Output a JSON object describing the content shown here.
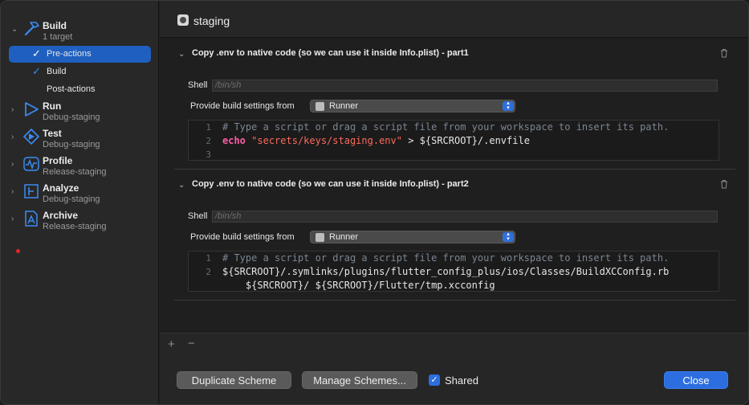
{
  "sidebar": {
    "actions": [
      {
        "title": "Build",
        "subtitle": "1 target",
        "icon": "hammer-icon",
        "expanded": true
      },
      {
        "title": "Run",
        "subtitle": "Debug-staging",
        "icon": "play-icon"
      },
      {
        "title": "Test",
        "subtitle": "Debug-staging",
        "icon": "test-diamond-icon"
      },
      {
        "title": "Profile",
        "subtitle": "Release-staging",
        "icon": "waveform-icon"
      },
      {
        "title": "Analyze",
        "subtitle": "Debug-staging",
        "icon": "analyze-icon"
      },
      {
        "title": "Archive",
        "subtitle": "Release-staging",
        "icon": "archive-icon"
      }
    ],
    "build_sub": [
      {
        "label": "Pre-actions",
        "checked": true,
        "selected": true
      },
      {
        "label": "Build",
        "checked": true,
        "selected": false
      },
      {
        "label": "Post-actions",
        "checked": false,
        "selected": false
      }
    ]
  },
  "header": {
    "title": "staging",
    "icon": "scheme-icon"
  },
  "phases": [
    {
      "title": "Copy .env to native code (so we can use it inside Info.plist) - part1",
      "shell_label": "Shell",
      "shell_placeholder": "/bin/sh",
      "provide_label": "Provide build settings from",
      "provide_value": "Runner",
      "code": [
        {
          "n": "1",
          "text": "# Type a script or drag a script file from your workspace to insert its path."
        },
        {
          "n": "2",
          "kw": "echo",
          "str": "\"secrets/keys/staging.env\"",
          "rest": " > ${SRCROOT}/.envfile"
        },
        {
          "n": "3",
          "text": ""
        }
      ]
    },
    {
      "title": "Copy .env to native code (so we can use it inside Info.plist) - part2",
      "shell_label": "Shell",
      "shell_placeholder": "/bin/sh",
      "provide_label": "Provide build settings from",
      "provide_value": "Runner",
      "code": [
        {
          "n": "1",
          "text": "# Type a script or drag a script file from your workspace to insert its path."
        },
        {
          "n": "2",
          "text": "${SRCROOT}/.symlinks/plugins/flutter_config_plus/ios/Classes/BuildXCConfig.rb"
        },
        {
          "n": "",
          "text": "    ${SRCROOT}/ ${SRCROOT}/Flutter/tmp.xcconfig"
        }
      ]
    }
  ],
  "toolbar": {
    "add": "+",
    "remove": "−"
  },
  "footer": {
    "duplicate": "Duplicate Scheme",
    "manage": "Manage Schemes...",
    "shared_label": "Shared",
    "shared_checked": true,
    "close": "Close"
  },
  "colors": {
    "accent": "#2c6ee0",
    "selection": "#1f5fbf",
    "keyword": "#fc5fa3",
    "string": "#fc6a5d",
    "comment": "#7b8591"
  }
}
